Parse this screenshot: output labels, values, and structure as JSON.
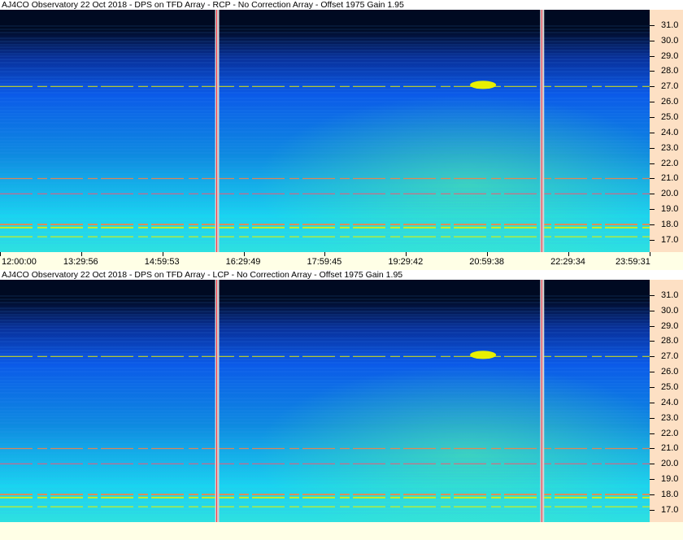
{
  "colors": {
    "sky_dark": "#000a22",
    "noise_blue": "#0b5ae8",
    "noise_cyan": "#19d4f0",
    "burst_yellow": "#e8f000",
    "rfi_red": "#ff5070",
    "axis_bg": "#fde0c4",
    "time_bg": "#ffffe6"
  },
  "panels": [
    {
      "title": "AJ4CO Observatory 22 Oct 2018 - DPS on TFD Array  - RCP  -  No Correction Array  -  Offset 1975  Gain 1.95"
    },
    {
      "title": "AJ4CO Observatory 22 Oct 2018 - DPS on TFD Array  - LCP  -  No Correction Array  -  Offset 1975  Gain 1.95"
    }
  ],
  "chart_data": [
    {
      "type": "heatmap",
      "title": "AJ4CO Observatory 22 Oct 2018 - DPS on TFD Array  - RCP  -  No Correction Array  -  Offset 1975  Gain 1.95",
      "ylabel": "",
      "xlabel": "",
      "ylim": [
        16.2,
        32.0
      ],
      "yticks": [
        "31.0",
        "30.0",
        "29.0",
        "28.0",
        "27.0",
        "26.0",
        "25.0",
        "24.0",
        "23.0",
        "22.0",
        "21.0",
        "20.0",
        "19.0",
        "18.0",
        "17.0"
      ],
      "xticks": [
        "12:00:00",
        "13:29:56",
        "14:59:53",
        "16:29:49",
        "17:59:45",
        "19:29:42",
        "20:59:38",
        "22:29:34",
        "23:59:31"
      ],
      "xlim": [
        "12:00:00",
        "23:59:31"
      ],
      "markers_time": [
        "16:00",
        "22:00"
      ],
      "bursts": [
        {
          "time": "20:55",
          "freq": 27.1
        }
      ],
      "rfi_lines": [
        20.0,
        17.8,
        18.0,
        17.2,
        21.0,
        27.0
      ]
    },
    {
      "type": "heatmap",
      "title": "AJ4CO Observatory 22 Oct 2018 - DPS on TFD Array  - LCP  -  No Correction Array  -  Offset 1975  Gain 1.95",
      "ylabel": "",
      "xlabel": "",
      "ylim": [
        16.2,
        32.0
      ],
      "yticks": [
        "31.0",
        "30.0",
        "29.0",
        "28.0",
        "27.0",
        "26.0",
        "25.0",
        "24.0",
        "23.0",
        "22.0",
        "21.0",
        "20.0",
        "19.0",
        "18.0",
        "17.0"
      ],
      "xticks": [],
      "xlim": [
        "12:00:00",
        "23:59:31"
      ],
      "markers_time": [
        "16:00",
        "22:00"
      ],
      "bursts": [
        {
          "time": "20:55",
          "freq": 27.1
        }
      ],
      "rfi_lines": [
        20.0,
        17.8,
        18.0,
        17.2,
        21.0,
        27.0
      ]
    }
  ]
}
